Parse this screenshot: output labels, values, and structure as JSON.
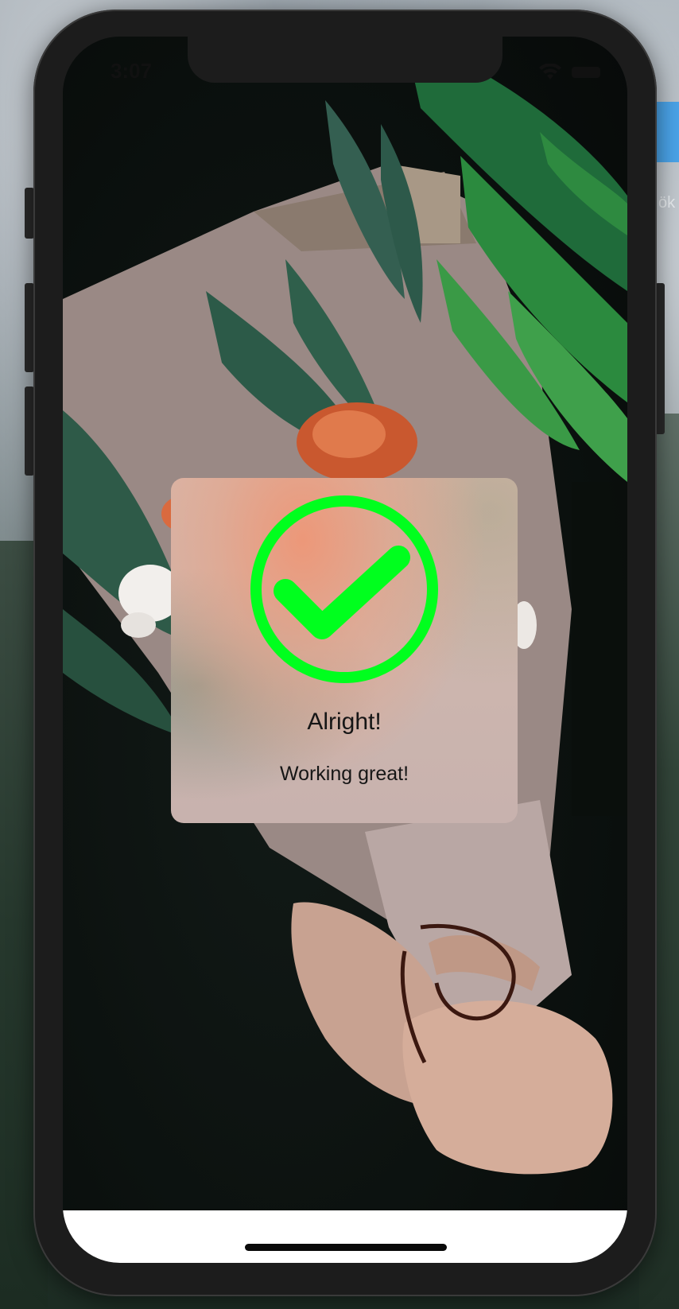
{
  "status_bar": {
    "time": "3:07",
    "wifi_icon": "wifi-icon",
    "battery_icon": "battery-icon"
  },
  "background_window": {
    "partial_text": "ök"
  },
  "hud": {
    "icon": "checkmark-circle-icon",
    "icon_color": "#00ff1e",
    "title": "Alright!",
    "subtitle": "Working great!"
  }
}
